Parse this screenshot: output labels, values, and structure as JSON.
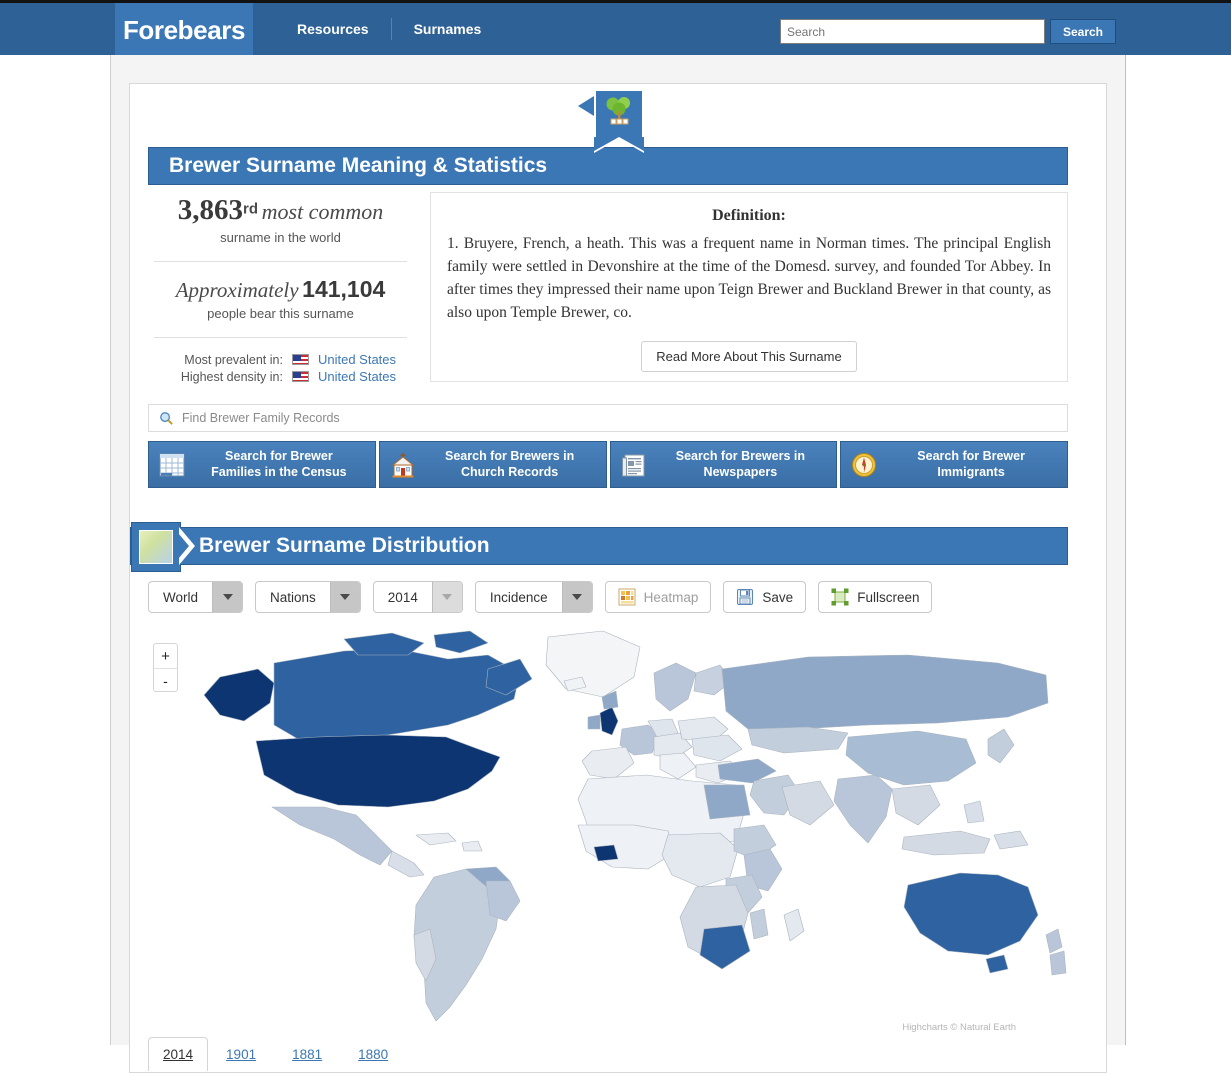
{
  "header": {
    "brand": "Forebears",
    "nav": [
      {
        "label": "Resources"
      },
      {
        "label": "Surnames"
      }
    ],
    "search": {
      "placeholder": "Search",
      "value": "",
      "button_label": "Search"
    }
  },
  "section_meaning": {
    "title": "Brewer Surname Meaning & Statistics",
    "badge_icon": "tree-badge-icon",
    "stats": {
      "rank_number": "3,863",
      "rank_suffix": "rd",
      "rank_phrase": "most common",
      "rank_sub": "surname in the world",
      "approx_word": "Approximately",
      "approx_number": "141,104",
      "approx_sub": "people bear this surname",
      "most_prevalent_label": "Most prevalent in:",
      "most_prevalent_value": "United States",
      "highest_density_label": "Highest density in:",
      "highest_density_value": "United States"
    },
    "definition": {
      "title": "Definition:",
      "text": "1. Bruyere, French, a heath. This was a frequent name in Norman times. The principal English family were settled in Devonshire at the time of the Domesd. survey, and founded Tor Abbey. In after times they impressed their name upon Teign Brewer and Buckland Brewer in that county, as also upon Temple Brewer, co.",
      "read_more_label": "Read More About This Surname"
    },
    "find_records": {
      "placeholder": "Find Brewer Family Records",
      "icon": "magnifier-icon"
    },
    "record_buttons": [
      {
        "icon": "census-grid-icon",
        "line1": "Search for Brewer",
        "line2": "Families in the Census"
      },
      {
        "icon": "church-icon",
        "line1": "Search for Brewers in",
        "line2": "Church Records"
      },
      {
        "icon": "newspaper-icon",
        "line1": "Search for Brewers in",
        "line2": "Newspapers"
      },
      {
        "icon": "compass-icon",
        "line1": "Search for Brewer",
        "line2": "Immigrants"
      }
    ]
  },
  "section_distribution": {
    "title": "Brewer Surname Distribution",
    "badge_icon": "map-badge-icon",
    "toolbar": {
      "selects": [
        {
          "name": "region",
          "value": "World",
          "disabled": false
        },
        {
          "name": "level",
          "value": "Nations",
          "disabled": false
        },
        {
          "name": "year",
          "value": "2014",
          "disabled": true
        },
        {
          "name": "metric",
          "value": "Incidence",
          "disabled": false
        }
      ],
      "buttons": [
        {
          "name": "heatmap",
          "label": "Heatmap",
          "icon": "heatmap-icon",
          "disabled": true
        },
        {
          "name": "save",
          "label": "Save",
          "icon": "floppy-disk-icon",
          "disabled": false
        },
        {
          "name": "fullscreen",
          "label": "Fullscreen",
          "icon": "fullscreen-icon",
          "disabled": false
        }
      ]
    },
    "map": {
      "zoom_in_label": "+",
      "zoom_out_label": "-",
      "credit": "Highcharts © Natural Earth",
      "colors": {
        "highest": "#0d3572",
        "high": "#2e62a0",
        "medium": "#8fa8c8",
        "low": "#b9c6da",
        "lowest": "#eef1f5",
        "no_data": "#f3f5f7",
        "border": "#aab4bf"
      }
    },
    "year_tabs": [
      {
        "label": "2014",
        "active": true
      },
      {
        "label": "1901",
        "active": false
      },
      {
        "label": "1881",
        "active": false
      },
      {
        "label": "1880",
        "active": false
      }
    ]
  }
}
